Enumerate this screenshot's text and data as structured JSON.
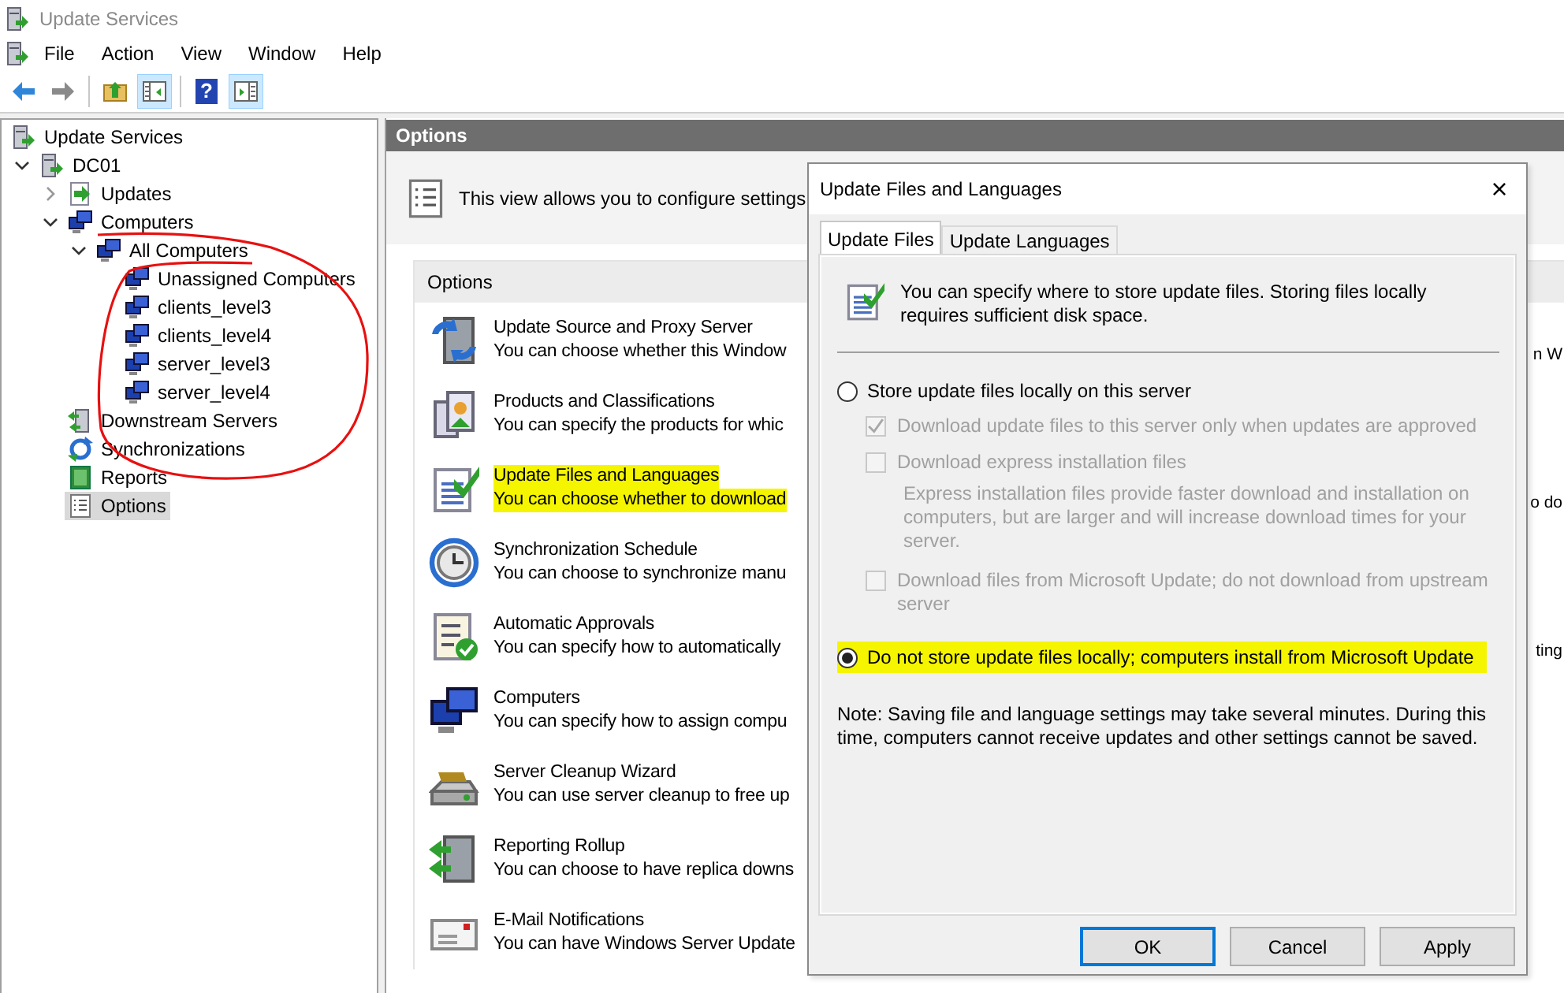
{
  "window": {
    "title": "Update Services"
  },
  "menu": [
    "File",
    "Action",
    "View",
    "Window",
    "Help"
  ],
  "toolbar": [
    {
      "kind": "back",
      "pressed": false
    },
    {
      "kind": "forward",
      "pressed": false
    },
    {
      "kind": "separator"
    },
    {
      "kind": "up",
      "pressed": false
    },
    {
      "kind": "tree-pane",
      "pressed": true
    },
    {
      "kind": "separator"
    },
    {
      "kind": "help",
      "glyph": "?",
      "pressed": false
    },
    {
      "kind": "action-pane",
      "pressed": true
    }
  ],
  "tree": {
    "items": [
      {
        "label": "Update Services",
        "kind": "server",
        "selected": false,
        "children": [
          {
            "label": "DC01",
            "kind": "server",
            "selected": false,
            "expanded": true,
            "children": [
              {
                "label": "Updates",
                "kind": "updates",
                "selected": false,
                "expanded": false
              },
              {
                "label": "Computers",
                "kind": "computers",
                "selected": false,
                "expanded": true,
                "children": [
                  {
                    "label": "All Computers",
                    "kind": "computers",
                    "selected": false,
                    "expanded": true,
                    "children": [
                      {
                        "label": "Unassigned Computers",
                        "kind": "computers",
                        "selected": false
                      },
                      {
                        "label": "clients_level3",
                        "kind": "computers",
                        "selected": false
                      },
                      {
                        "label": "clients_level4",
                        "kind": "computers",
                        "selected": false
                      },
                      {
                        "label": "server_level3",
                        "kind": "computers",
                        "selected": false
                      },
                      {
                        "label": "server_level4",
                        "kind": "computers",
                        "selected": false
                      }
                    ]
                  }
                ]
              },
              {
                "label": "Downstream Servers",
                "kind": "downstream",
                "selected": false
              },
              {
                "label": "Synchronizations",
                "kind": "sync",
                "selected": false
              },
              {
                "label": "Reports",
                "kind": "reports",
                "selected": false
              },
              {
                "label": "Options",
                "kind": "options",
                "selected": true
              }
            ]
          }
        ]
      }
    ]
  },
  "content": {
    "title": "Options",
    "intro": "This view allows you to configure settings",
    "group_title": "Options",
    "items": [
      {
        "kind": "proxy",
        "title": "Update Source and Proxy Server",
        "description": "You can choose whether this Window",
        "tail": "n W",
        "highlighted": false
      },
      {
        "kind": "products",
        "title": "Products and Classifications",
        "description": "You can specify the products for whic",
        "highlighted": false
      },
      {
        "kind": "files",
        "title": "Update Files and Languages",
        "description": "You can choose whether to download",
        "tail": "o do",
        "highlighted": true
      },
      {
        "kind": "schedule",
        "title": "Synchronization Schedule",
        "description": "You can choose to synchronize manu",
        "highlighted": false
      },
      {
        "kind": "approvals",
        "title": "Automatic Approvals",
        "description": "You can specify how to automatically",
        "tail": "ting",
        "highlighted": false
      },
      {
        "kind": "computers",
        "title": "Computers",
        "description": "You can specify how to assign compu",
        "highlighted": false
      },
      {
        "kind": "cleanup",
        "title": "Server Cleanup Wizard",
        "description": "You can use server cleanup to free up",
        "highlighted": false
      },
      {
        "kind": "rollup",
        "title": "Reporting Rollup",
        "description": "You can choose to have replica downs",
        "highlighted": false
      },
      {
        "kind": "email",
        "title": "E-Mail Notifications",
        "description": "You can have Windows Server Update",
        "highlighted": false
      }
    ]
  },
  "dialog": {
    "title": "Update Files and Languages",
    "close": "×",
    "tabs": [
      {
        "label": "Update Files",
        "selected": true
      },
      {
        "label": "Update Languages",
        "selected": false
      }
    ],
    "info": "You can specify where to store update files. Storing files locally requires sufficient disk space.",
    "choices": [
      {
        "kind": "radio",
        "label": "Store update files locally on this server",
        "checked": false,
        "highlighted": false,
        "children": [
          {
            "kind": "checkbox",
            "label": "Download update files to this server only when updates are approved",
            "checked": true,
            "disabled": true
          },
          {
            "kind": "checkbox",
            "label": "Download express installation files",
            "checked": false,
            "disabled": true,
            "description": "Express installation files provide faster download and installation on computers, but are larger and will increase download times for your server."
          },
          {
            "kind": "checkbox",
            "label": "Download files from Microsoft Update; do not download from upstream server",
            "checked": false,
            "disabled": true
          }
        ]
      },
      {
        "kind": "radio",
        "label": "Do not store update files locally; computers install from Microsoft Update",
        "checked": true,
        "highlighted": true
      }
    ],
    "note": "Note: Saving file and language settings may take several minutes. During this time, computers cannot receive updates and other settings cannot be saved.",
    "buttons": [
      {
        "label": "OK",
        "default": true
      },
      {
        "label": "Cancel",
        "default": false
      },
      {
        "label": "Apply",
        "default": false
      }
    ]
  }
}
